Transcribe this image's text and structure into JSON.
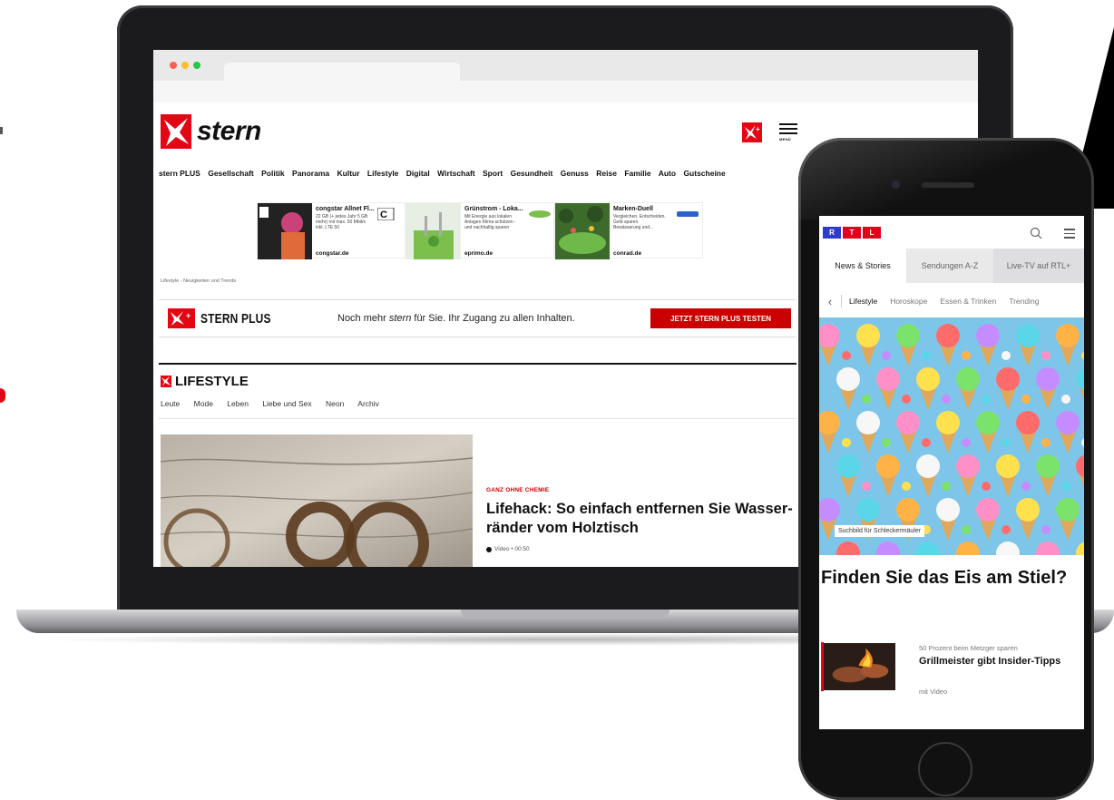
{
  "desktop": {
    "site_name": "stern",
    "plus_badge": "✕+",
    "menu_label": "MENÜ",
    "nav": [
      "stern PLUS",
      "Gesellschaft",
      "Politik",
      "Panorama",
      "Kultur",
      "Lifestyle",
      "Digital",
      "Wirtschaft",
      "Sport",
      "Gesundheit",
      "Genuss",
      "Reise",
      "Familie",
      "Auto",
      "Gutscheine"
    ],
    "ads": [
      {
        "title": "congstar Allnet Fl...",
        "text": "22 GB (+ jedes Jahr 5 GB mehr) mit max. 50 Mbit/s inkl. LTE 50",
        "domain": "congstar.de"
      },
      {
        "title": "Grünstrom - Loka...",
        "text": "Mit Energie aus lokalen Anlagen Klima schützen - und nachhaltig sparen",
        "domain": "eprimo.de"
      },
      {
        "title": "Marken-Duell",
        "text": "Vergleichen. Entscheiden. Geld sparen. Bewässerung und...",
        "domain": "conrad.de"
      }
    ],
    "breadcrumb": "Lifestyle - Neuigkeiten und Trends",
    "plus_promo": {
      "logo_text": "STERN PLUS",
      "tagline_before": "Noch mehr ",
      "tagline_em": "stern",
      "tagline_after": " für Sie. Ihr Zugang zu allen Inhalten.",
      "cta": "JETZT STERN PLUS TESTEN"
    },
    "section": {
      "title": "LIFESTYLE",
      "subnav": [
        "Leute",
        "Mode",
        "Leben",
        "Liebe und Sex",
        "Neon",
        "Archiv"
      ]
    },
    "article": {
      "kicker": "GANZ OHNE CHEMIE",
      "headline": "Lifehack: So einfach entfernen Sie Wasser-ränder vom Holztisch",
      "meta": "Video • 00:50"
    }
  },
  "mobile": {
    "logo_letters": [
      "R",
      "T",
      "L"
    ],
    "tabs": [
      "News & Stories",
      "Sendungen A-Z",
      "Live-TV auf RTL+"
    ],
    "back": "‹",
    "subnav": [
      "Lifestyle",
      "Horoskope",
      "Essen & Trinken",
      "Trending"
    ],
    "hero_caption": "Suchbild für Schleckermäuler",
    "headline": "Finden Sie das Eis am Stiel?",
    "teaser": {
      "kicker": "50 Prozent beim Metzger sparen",
      "title": "Grillmeister gibt Insider-Tipps",
      "meta": "mit Video"
    }
  },
  "colors": {
    "stern_red": "#e30613",
    "cta_red": "#cc0000",
    "rtl_red": "#e2001a",
    "rtl_blue": "#2f3cc7"
  }
}
